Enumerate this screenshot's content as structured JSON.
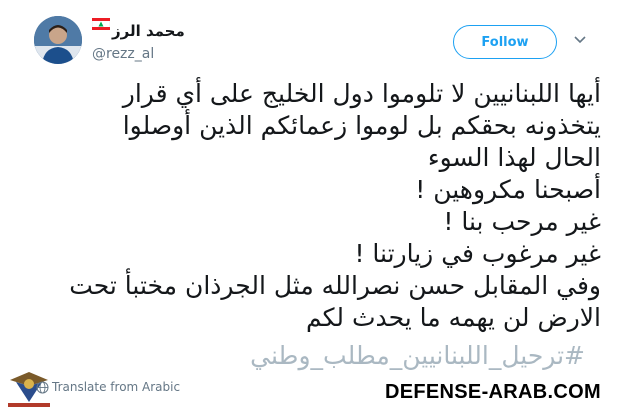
{
  "profile": {
    "display_name": "محمد الرز",
    "handle": "@rezz_al",
    "flag": "lebanon-flag-icon",
    "avatar": "avatar"
  },
  "actions": {
    "follow_label": "Follow",
    "menu_icon": "chevron-down-icon"
  },
  "tweet": {
    "lines": [
      "أيها اللبنانيين لا تلوموا دول الخليج على أي قرار",
      "يتخذونه بحقكم بل لوموا زعمائكم الذين أوصلوا",
      "الحال لهذا السوء",
      "أصبحنا مكروهين !",
      "غير مرحب بنا !",
      "غير مرغوب في زيارتنا !",
      "وفي المقابل حسن نصرالله مثل الجرذان مختبأ تحت",
      "الارض لن يهمه ما يحدث لكم"
    ],
    "hashtag": "#ترحيل_اللبنانيين_مطلب_وطني"
  },
  "translate": {
    "label": "Translate from Arabic",
    "icon": "globe-icon"
  },
  "watermark": {
    "text": "DEFENSE-ARAB.COM",
    "logo": "defense-arab-logo"
  },
  "colors": {
    "follow": "#1da1f2",
    "hashtag": "#aab8c2",
    "secondary_text": "#657786"
  }
}
